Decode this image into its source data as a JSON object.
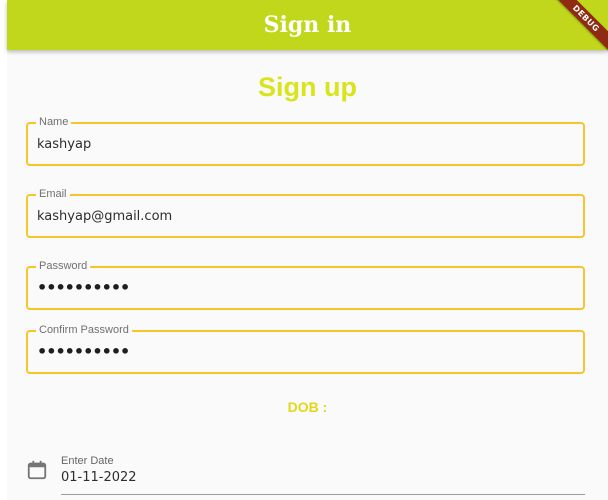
{
  "appbar": {
    "title": "Sign in",
    "color": "#c0d71b",
    "debug_banner": "DEBUG"
  },
  "form": {
    "heading": "Sign up",
    "fields": [
      {
        "label": "Name",
        "value": "kashyap"
      },
      {
        "label": "Email",
        "value": "kashyap@gmail.com"
      },
      {
        "label": "Password",
        "value": "••••••••••"
      },
      {
        "label": "Confirm Password",
        "value": "••••••••••"
      }
    ],
    "dob_label": "DOB :",
    "date": {
      "label": "Enter Date",
      "value": "01-11-2022",
      "icon": "calendar-icon"
    },
    "border_color": "#f6c52c",
    "accent_color": "#d9e51c"
  }
}
